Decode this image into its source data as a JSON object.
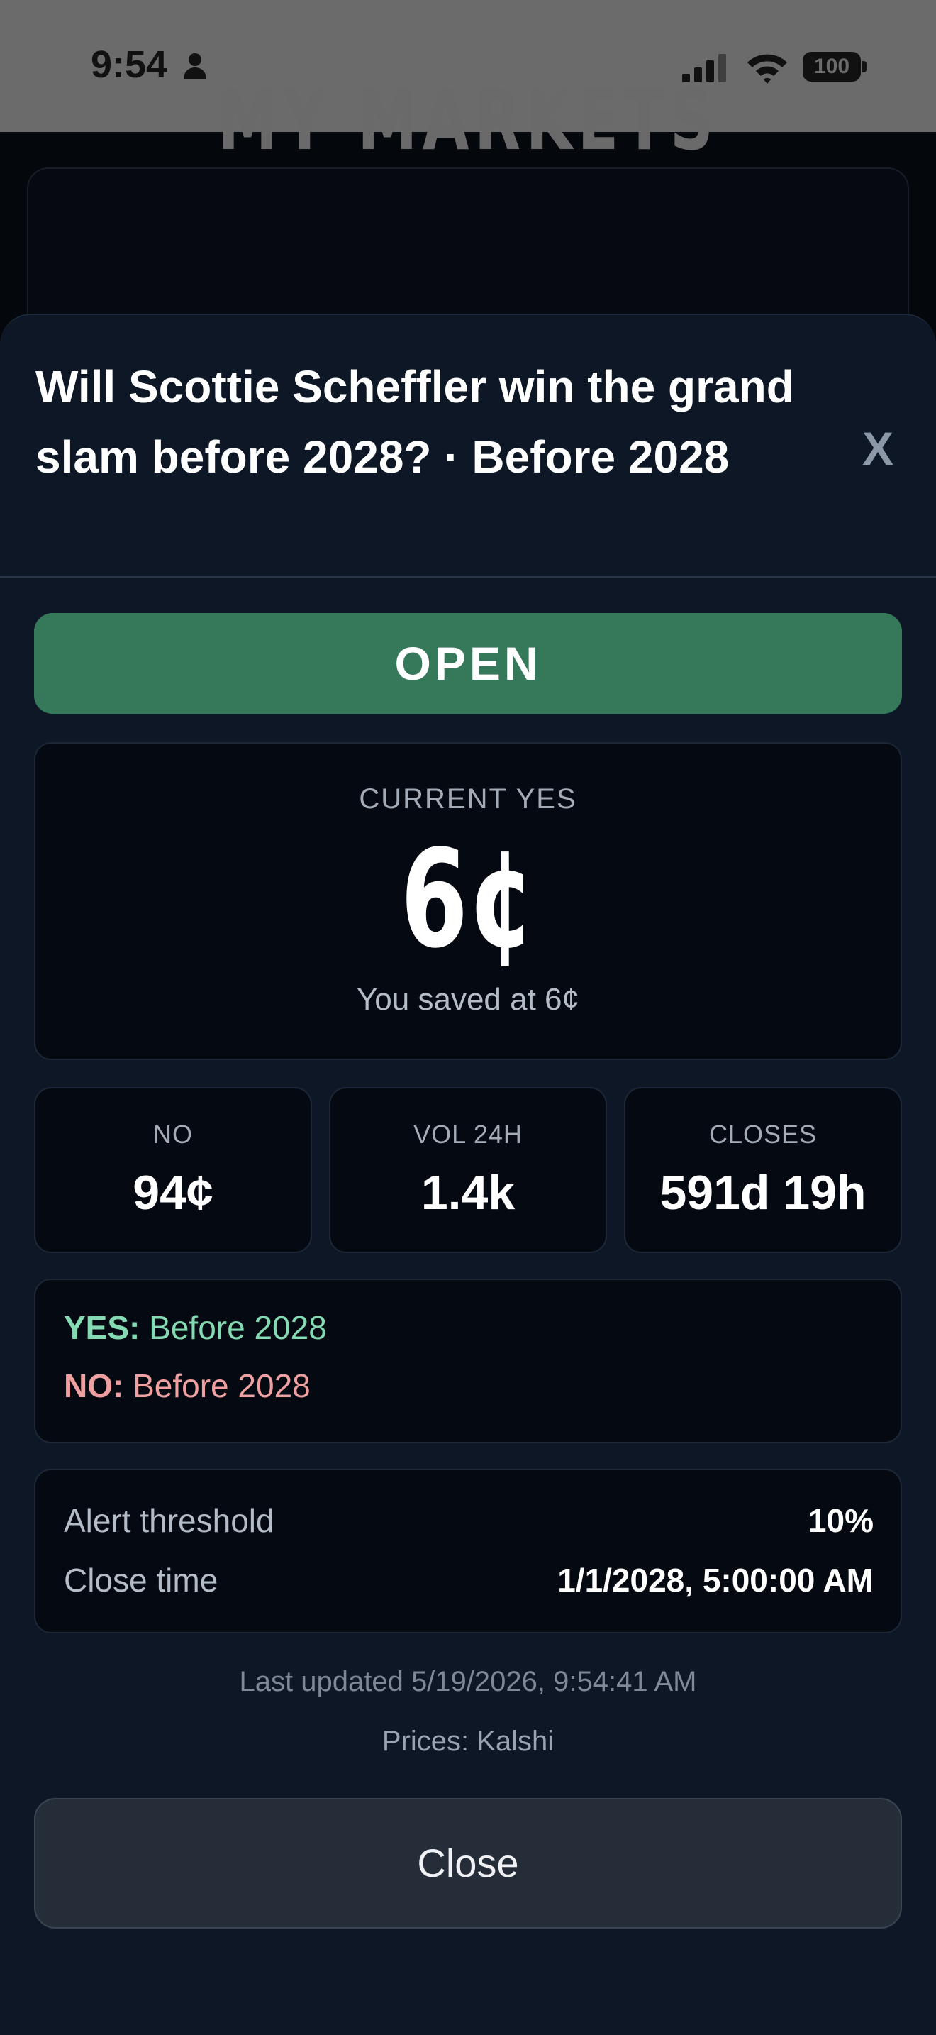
{
  "status_bar": {
    "time": "9:54",
    "battery": "100",
    "icons": [
      "person-icon",
      "signal-icon",
      "wifi-icon",
      "battery-icon"
    ]
  },
  "background": {
    "title": "MY MARKETS",
    "subtitle": ""
  },
  "sheet": {
    "title": "Will Scottie Scheffler win the grand slam before 2028? · Before 2028",
    "close_icon": "X",
    "status": "OPEN",
    "status_color": "#35785a",
    "current": {
      "label": "CURRENT YES",
      "value": "6¢",
      "saved": "You saved at 6¢"
    },
    "stats": [
      {
        "label": "NO",
        "value": "94¢"
      },
      {
        "label": "VOL 24H",
        "value": "1.4k"
      },
      {
        "label": "CLOSES",
        "value": "591d 19h"
      }
    ],
    "outcomes": {
      "yes_key": "YES:",
      "yes_value": "Before 2028",
      "no_key": "NO:",
      "no_value": "Before 2028",
      "yes_color": "#84dbb3",
      "no_color": "#f0a0a0"
    },
    "info": {
      "alert_label": "Alert threshold",
      "alert_value": "10%",
      "close_label": "Close time",
      "close_value": "1/1/2028, 5:00:00 AM"
    },
    "last_updated": "Last updated 5/19/2026, 9:54:41 AM",
    "prices_source": "Prices: Kalshi",
    "close_button": "Close"
  }
}
